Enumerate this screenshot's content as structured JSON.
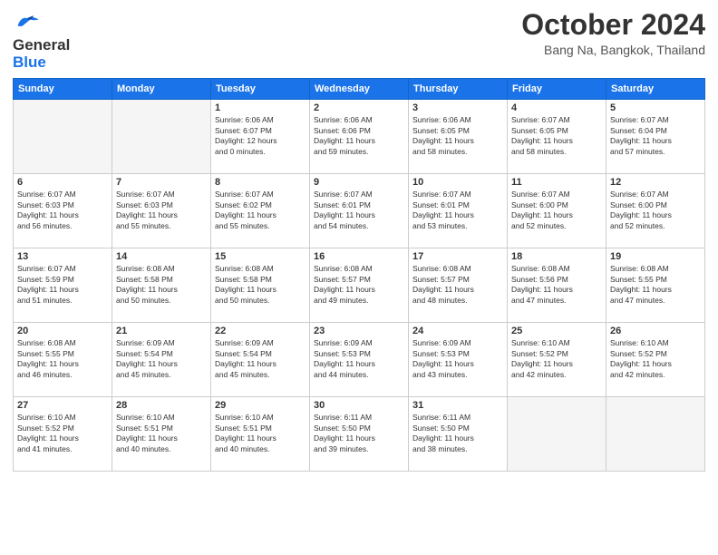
{
  "header": {
    "logo_line1": "General",
    "logo_line2": "Blue",
    "month": "October 2024",
    "location": "Bang Na, Bangkok, Thailand"
  },
  "weekdays": [
    "Sunday",
    "Monday",
    "Tuesday",
    "Wednesday",
    "Thursday",
    "Friday",
    "Saturday"
  ],
  "weeks": [
    [
      {
        "day": "",
        "info": ""
      },
      {
        "day": "",
        "info": ""
      },
      {
        "day": "1",
        "info": "Sunrise: 6:06 AM\nSunset: 6:07 PM\nDaylight: 12 hours\nand 0 minutes."
      },
      {
        "day": "2",
        "info": "Sunrise: 6:06 AM\nSunset: 6:06 PM\nDaylight: 11 hours\nand 59 minutes."
      },
      {
        "day": "3",
        "info": "Sunrise: 6:06 AM\nSunset: 6:05 PM\nDaylight: 11 hours\nand 58 minutes."
      },
      {
        "day": "4",
        "info": "Sunrise: 6:07 AM\nSunset: 6:05 PM\nDaylight: 11 hours\nand 58 minutes."
      },
      {
        "day": "5",
        "info": "Sunrise: 6:07 AM\nSunset: 6:04 PM\nDaylight: 11 hours\nand 57 minutes."
      }
    ],
    [
      {
        "day": "6",
        "info": "Sunrise: 6:07 AM\nSunset: 6:03 PM\nDaylight: 11 hours\nand 56 minutes."
      },
      {
        "day": "7",
        "info": "Sunrise: 6:07 AM\nSunset: 6:03 PM\nDaylight: 11 hours\nand 55 minutes."
      },
      {
        "day": "8",
        "info": "Sunrise: 6:07 AM\nSunset: 6:02 PM\nDaylight: 11 hours\nand 55 minutes."
      },
      {
        "day": "9",
        "info": "Sunrise: 6:07 AM\nSunset: 6:01 PM\nDaylight: 11 hours\nand 54 minutes."
      },
      {
        "day": "10",
        "info": "Sunrise: 6:07 AM\nSunset: 6:01 PM\nDaylight: 11 hours\nand 53 minutes."
      },
      {
        "day": "11",
        "info": "Sunrise: 6:07 AM\nSunset: 6:00 PM\nDaylight: 11 hours\nand 52 minutes."
      },
      {
        "day": "12",
        "info": "Sunrise: 6:07 AM\nSunset: 6:00 PM\nDaylight: 11 hours\nand 52 minutes."
      }
    ],
    [
      {
        "day": "13",
        "info": "Sunrise: 6:07 AM\nSunset: 5:59 PM\nDaylight: 11 hours\nand 51 minutes."
      },
      {
        "day": "14",
        "info": "Sunrise: 6:08 AM\nSunset: 5:58 PM\nDaylight: 11 hours\nand 50 minutes."
      },
      {
        "day": "15",
        "info": "Sunrise: 6:08 AM\nSunset: 5:58 PM\nDaylight: 11 hours\nand 50 minutes."
      },
      {
        "day": "16",
        "info": "Sunrise: 6:08 AM\nSunset: 5:57 PM\nDaylight: 11 hours\nand 49 minutes."
      },
      {
        "day": "17",
        "info": "Sunrise: 6:08 AM\nSunset: 5:57 PM\nDaylight: 11 hours\nand 48 minutes."
      },
      {
        "day": "18",
        "info": "Sunrise: 6:08 AM\nSunset: 5:56 PM\nDaylight: 11 hours\nand 47 minutes."
      },
      {
        "day": "19",
        "info": "Sunrise: 6:08 AM\nSunset: 5:55 PM\nDaylight: 11 hours\nand 47 minutes."
      }
    ],
    [
      {
        "day": "20",
        "info": "Sunrise: 6:08 AM\nSunset: 5:55 PM\nDaylight: 11 hours\nand 46 minutes."
      },
      {
        "day": "21",
        "info": "Sunrise: 6:09 AM\nSunset: 5:54 PM\nDaylight: 11 hours\nand 45 minutes."
      },
      {
        "day": "22",
        "info": "Sunrise: 6:09 AM\nSunset: 5:54 PM\nDaylight: 11 hours\nand 45 minutes."
      },
      {
        "day": "23",
        "info": "Sunrise: 6:09 AM\nSunset: 5:53 PM\nDaylight: 11 hours\nand 44 minutes."
      },
      {
        "day": "24",
        "info": "Sunrise: 6:09 AM\nSunset: 5:53 PM\nDaylight: 11 hours\nand 43 minutes."
      },
      {
        "day": "25",
        "info": "Sunrise: 6:10 AM\nSunset: 5:52 PM\nDaylight: 11 hours\nand 42 minutes."
      },
      {
        "day": "26",
        "info": "Sunrise: 6:10 AM\nSunset: 5:52 PM\nDaylight: 11 hours\nand 42 minutes."
      }
    ],
    [
      {
        "day": "27",
        "info": "Sunrise: 6:10 AM\nSunset: 5:52 PM\nDaylight: 11 hours\nand 41 minutes."
      },
      {
        "day": "28",
        "info": "Sunrise: 6:10 AM\nSunset: 5:51 PM\nDaylight: 11 hours\nand 40 minutes."
      },
      {
        "day": "29",
        "info": "Sunrise: 6:10 AM\nSunset: 5:51 PM\nDaylight: 11 hours\nand 40 minutes."
      },
      {
        "day": "30",
        "info": "Sunrise: 6:11 AM\nSunset: 5:50 PM\nDaylight: 11 hours\nand 39 minutes."
      },
      {
        "day": "31",
        "info": "Sunrise: 6:11 AM\nSunset: 5:50 PM\nDaylight: 11 hours\nand 38 minutes."
      },
      {
        "day": "",
        "info": ""
      },
      {
        "day": "",
        "info": ""
      }
    ]
  ]
}
